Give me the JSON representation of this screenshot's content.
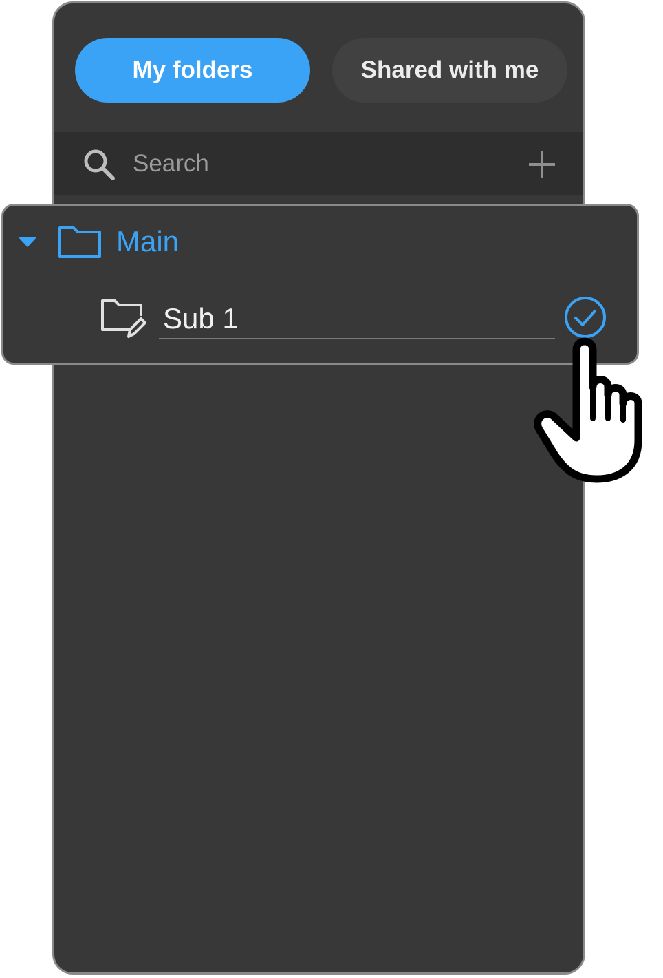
{
  "tabs": {
    "my_folders": "My folders",
    "shared_with_me": "Shared with me",
    "active": "my_folders"
  },
  "search": {
    "placeholder": "Search",
    "value": ""
  },
  "tree": {
    "root": {
      "label": "Main",
      "expanded": true
    },
    "child_edit": {
      "value": "Sub 1"
    }
  },
  "colors": {
    "accent": "#3ba3f5",
    "panel_bg": "#383838",
    "search_bg": "#2e2e2e",
    "border": "#8a8a8a"
  },
  "icons": {
    "search": "search-icon",
    "add": "plus-icon",
    "caret": "caret-down-icon",
    "folder": "folder-icon",
    "folder_edit": "folder-edit-icon",
    "confirm": "check-circle-icon",
    "cursor": "hand-pointer-cursor"
  }
}
